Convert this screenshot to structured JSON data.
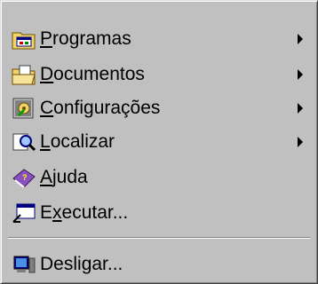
{
  "menu": {
    "items": [
      {
        "label": "Programas",
        "icon": "programs-folder-icon",
        "has_submenu": true,
        "underline_index": 0
      },
      {
        "label": "Documentos",
        "icon": "documents-folder-icon",
        "has_submenu": true,
        "underline_index": 0
      },
      {
        "label": "Configurações",
        "icon": "settings-icon",
        "has_submenu": true,
        "underline_index": 0
      },
      {
        "label": "Localizar",
        "icon": "search-icon",
        "has_submenu": true,
        "underline_index": 0
      },
      {
        "label": "Ajuda",
        "icon": "help-book-icon",
        "has_submenu": false,
        "underline_index": 0
      },
      {
        "label": "Executar...",
        "icon": "run-icon",
        "has_submenu": false,
        "underline_index": 1
      },
      {
        "label": "Desligar...",
        "icon": "shutdown-icon",
        "has_submenu": false,
        "underline_index": 5
      }
    ]
  },
  "colors": {
    "menu_bg": "#c0c0c0",
    "text": "#000000",
    "folder_yellow": "#f2d46b",
    "accent_blue": "#000080"
  }
}
